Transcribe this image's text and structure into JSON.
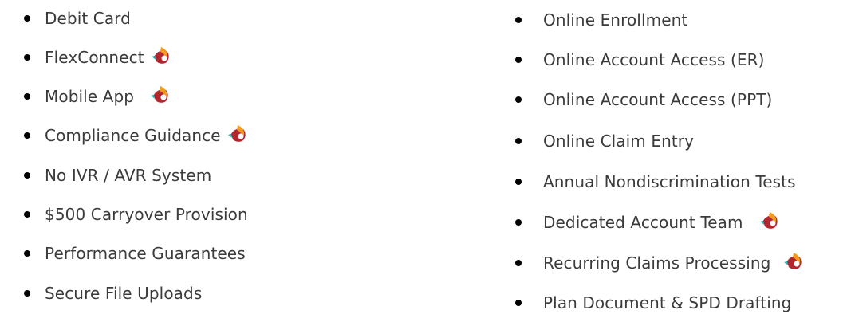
{
  "left_list": [
    {
      "label": "Debit Card",
      "badge": false
    },
    {
      "label": "FlexConnect",
      "badge": true
    },
    {
      "label": "Mobile App",
      "badge": true
    },
    {
      "label": "Compliance Guidance",
      "badge": true
    },
    {
      "label": "No IVR / AVR System",
      "badge": false
    },
    {
      "label": "$500 Carryover Provision",
      "badge": false
    },
    {
      "label": "Performance Guarantees",
      "badge": false
    },
    {
      "label": "Secure File Uploads",
      "badge": false
    }
  ],
  "right_list": [
    {
      "label": "Online Enrollment",
      "badge": false
    },
    {
      "label": "Online Account Access (ER)",
      "badge": false
    },
    {
      "label": "Online Account Access (PPT)",
      "badge": false
    },
    {
      "label": "Online Claim Entry",
      "badge": false
    },
    {
      "label": "Annual Nondiscrimination Tests",
      "badge": false
    },
    {
      "label": "Dedicated Account Team",
      "badge": true
    },
    {
      "label": "Recurring Claims Processing",
      "badge": true
    },
    {
      "label": "Plan Document & SPD Drafting",
      "badge": false
    }
  ],
  "badge_icon": "flame-leaf-icon",
  "colors": {
    "text": "#3b3b3b",
    "bullet": "#000000",
    "badge_red": "#b1262f",
    "badge_orange": "#f39a1f",
    "badge_teal": "#2fb3b4",
    "badge_yellow": "#ffc93c"
  }
}
